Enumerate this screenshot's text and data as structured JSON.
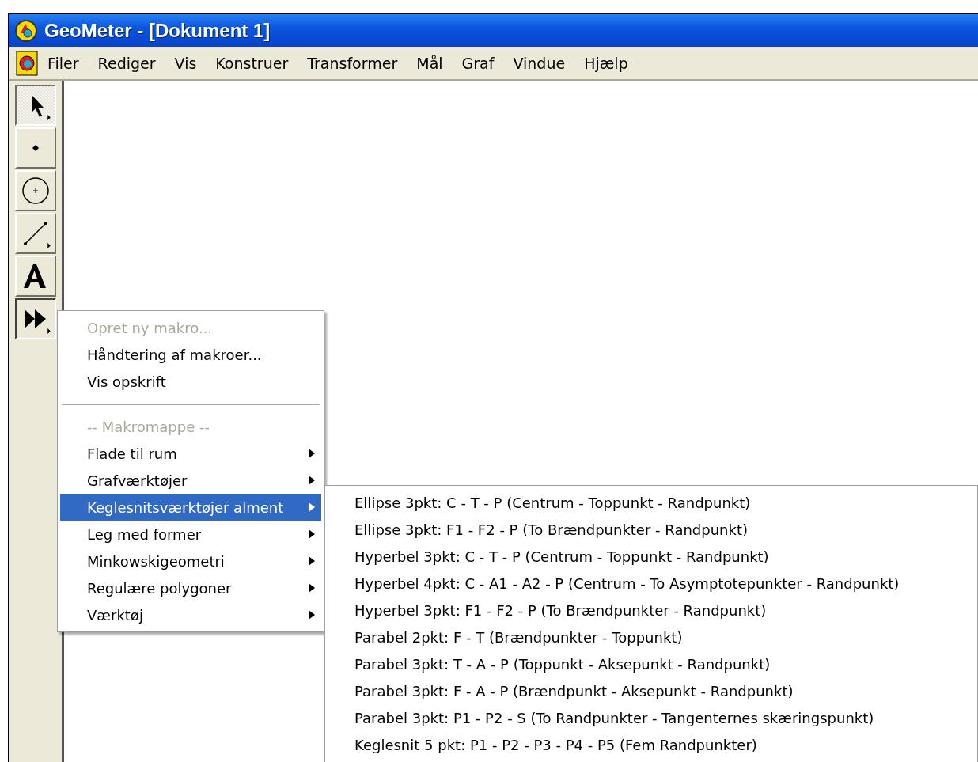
{
  "window": {
    "title": "GeoMeter - [Dokument 1]"
  },
  "menubar": [
    "Filer",
    "Rediger",
    "Vis",
    "Konstruer",
    "Transformer",
    "Mål",
    "Graf",
    "Vindue",
    "Hjælp"
  ],
  "tools": [
    {
      "kind": "arrow",
      "selected": true,
      "pressed": false,
      "submenu": true
    },
    {
      "kind": "point",
      "selected": false,
      "pressed": false,
      "submenu": false
    },
    {
      "kind": "circle",
      "selected": false,
      "pressed": false,
      "submenu": false
    },
    {
      "kind": "line",
      "selected": false,
      "pressed": false,
      "submenu": true
    },
    {
      "kind": "text",
      "selected": false,
      "pressed": false,
      "submenu": false
    },
    {
      "kind": "macro",
      "selected": false,
      "pressed": true,
      "submenu": true
    }
  ],
  "macro_menu": [
    {
      "kind": "item",
      "label": "Opret ny makro...",
      "disabled": true,
      "submenu": false,
      "selected": false
    },
    {
      "kind": "item",
      "label": "Håndtering af makroer...",
      "disabled": false,
      "submenu": false,
      "selected": false
    },
    {
      "kind": "item",
      "label": "Vis opskrift",
      "disabled": false,
      "submenu": false,
      "selected": false
    },
    {
      "kind": "separator"
    },
    {
      "kind": "item",
      "label": "-- Makromappe --",
      "disabled": true,
      "submenu": false,
      "selected": false
    },
    {
      "kind": "item",
      "label": "Flade til rum",
      "disabled": false,
      "submenu": true,
      "selected": false
    },
    {
      "kind": "item",
      "label": "Grafværktøjer",
      "disabled": false,
      "submenu": true,
      "selected": false
    },
    {
      "kind": "item",
      "label": "Keglesnitsværktøjer alment",
      "disabled": false,
      "submenu": true,
      "selected": true
    },
    {
      "kind": "item",
      "label": "Leg med former",
      "disabled": false,
      "submenu": true,
      "selected": false
    },
    {
      "kind": "item",
      "label": "Minkowskigeometri",
      "disabled": false,
      "submenu": true,
      "selected": false
    },
    {
      "kind": "item",
      "label": "Regulære polygoner",
      "disabled": false,
      "submenu": true,
      "selected": false
    },
    {
      "kind": "item",
      "label": "Værktøj",
      "disabled": false,
      "submenu": true,
      "selected": false
    }
  ],
  "submenu": [
    "Ellipse 3pkt: C - T - P (Centrum - Toppunkt - Randpunkt)",
    "Ellipse 3pkt: F1 - F2 - P (To Brændpunkter - Randpunkt)",
    "Hyperbel 3pkt: C - T - P (Centrum - Toppunkt - Randpunkt)",
    "Hyperbel 4pkt: C - A1 - A2 - P (Centrum - To Asymptotepunkter - Randpunkt)",
    "Hyperbel 3pkt: F1 - F2 - P (To Brændpunkter - Randpunkt)",
    "Parabel 2pkt: F - T (Brændpunkter - Toppunkt)",
    "Parabel 3pkt: T - A - P (Toppunkt - Aksepunkt - Randpunkt)",
    "Parabel 3pkt: F - A - P (Brændpunkt - Aksepunkt - Randpunkt)",
    "Parabel 3pkt: P1 - P2 - S (To Randpunkter - Tangenternes skæringspunkt)",
    "Keglesnit 5 pkt: P1 - P2 - P3 - P4 - P5 (Fem Randpunkter)"
  ]
}
